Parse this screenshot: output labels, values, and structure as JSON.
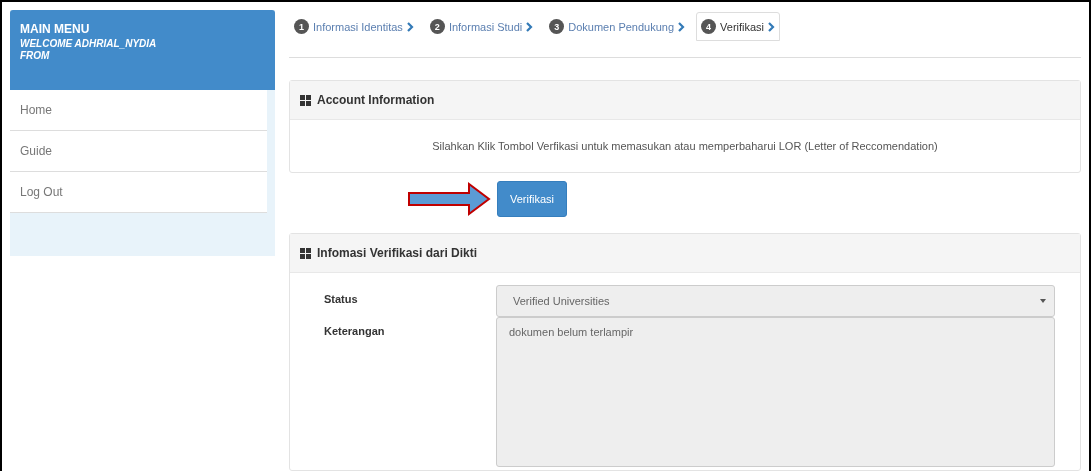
{
  "sidebar": {
    "title": "MAIN MENU",
    "subtitle": "WELCOME ADHRIAL_NYDIA FROM",
    "items": [
      {
        "label": "Home"
      },
      {
        "label": "Guide"
      },
      {
        "label": "Log Out"
      }
    ]
  },
  "steps": [
    {
      "number": "1",
      "label": "Informasi Identitas",
      "selected": false
    },
    {
      "number": "2",
      "label": "Informasi Studi",
      "selected": false
    },
    {
      "number": "3",
      "label": "Dokumen Pendukung",
      "selected": false
    },
    {
      "number": "4",
      "label": "Verifikasi",
      "selected": true
    }
  ],
  "account_panel": {
    "title": "Account Information",
    "message": "Silahkan Klik Tombol Verfikasi untuk memasukan atau memperbaharui LOR (Letter of Reccomendation)",
    "button": "Verifikasi"
  },
  "verification_panel": {
    "title": "Infomasi Verifikasi dari Dikti",
    "fields": [
      {
        "kind": "select",
        "label": "Status",
        "value": "Verified Universities",
        "disabled": true
      },
      {
        "kind": "textarea",
        "label": "Keterangan",
        "value": "dokumen belum terlampir",
        "disabled": true
      }
    ]
  }
}
